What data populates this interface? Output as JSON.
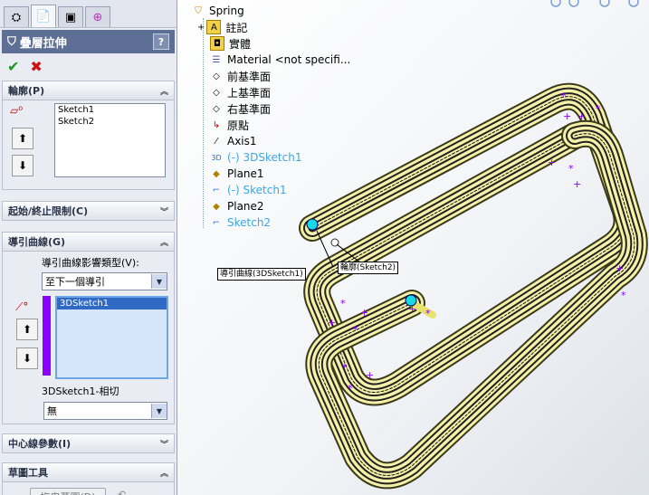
{
  "feature": {
    "title": "疊層拉伸",
    "help": "?"
  },
  "actions": {
    "ok": "✔",
    "cancel": "✖"
  },
  "profiles": {
    "label": "輪廓(P)",
    "items": [
      "Sketch1",
      "Sketch2"
    ]
  },
  "start_end": {
    "label": "起始/終止限制(C)"
  },
  "guides": {
    "label": "導引曲線(G)",
    "influence_label": "導引曲線影響類型(V):",
    "influence_value": "至下一個導引",
    "items": [
      "3DSketch1"
    ],
    "tangency_label": "3DSketch1-相切",
    "tangency_value": "無"
  },
  "centerline": {
    "label": "中心線參數(I)"
  },
  "sketch_tools": {
    "label": "草圖工具",
    "drag_button": "拖曳草圖(D)"
  },
  "tree": {
    "items": [
      {
        "label": "Spring",
        "icon": "part-icon"
      },
      {
        "label": "註記",
        "icon": "annotations-icon"
      },
      {
        "label": "實體",
        "icon": "solid-bodies-icon"
      },
      {
        "label": "Material <not specifi...",
        "icon": "material-icon"
      },
      {
        "label": "前基準面",
        "icon": "plane-icon"
      },
      {
        "label": "上基準面",
        "icon": "plane-icon"
      },
      {
        "label": "右基準面",
        "icon": "plane-icon"
      },
      {
        "label": "原點",
        "icon": "origin-icon"
      },
      {
        "label": "Axis1",
        "icon": "axis-icon"
      },
      {
        "label": "(-) 3DSketch1",
        "icon": "3dsketch-icon"
      },
      {
        "label": "Plane1",
        "icon": "plane-icon"
      },
      {
        "label": "(-) Sketch1",
        "icon": "sketch-icon"
      },
      {
        "label": "Plane2",
        "icon": "plane-icon"
      },
      {
        "label": "Sketch2",
        "icon": "sketch-icon"
      }
    ]
  },
  "callouts": {
    "guide": "導引曲線(3DSketch1)",
    "profile": "輪廓(Sketch2)"
  },
  "colors": {
    "header": "#5d6f94",
    "selection": "#316ac5",
    "guide_bar": "#8b00ff",
    "model_fill": "#f6f1a8",
    "highlight_blue": "#3aa6e8"
  }
}
